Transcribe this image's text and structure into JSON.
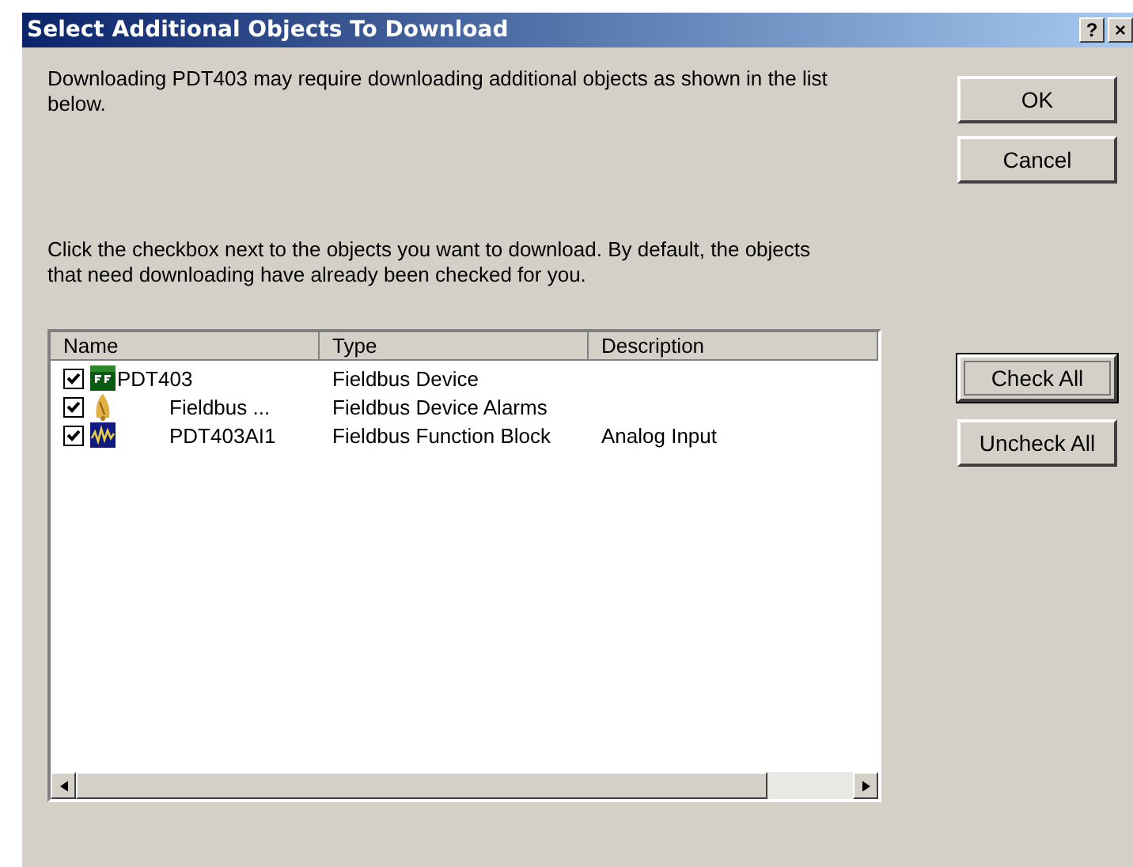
{
  "window": {
    "title": "Select Additional Objects To Download",
    "title_buttons": [
      "?",
      "×"
    ]
  },
  "intro": "Downloading PDT403 may require downloading additional objects as shown in the list below.",
  "instructions": "Click the checkbox next to the objects you want to download. By default, the objects that need downloading have already been checked for you.",
  "dialog_buttons": [
    {
      "label": "OK",
      "focused": false
    },
    {
      "label": "Cancel",
      "focused": false
    }
  ],
  "list_buttons": [
    {
      "label": "Check All",
      "focused": true
    },
    {
      "label": "Uncheck All",
      "focused": false
    }
  ],
  "table": {
    "columns": [
      "Name",
      "Type",
      "Description"
    ],
    "rows": [
      {
        "name": "PDT403",
        "type": "Fieldbus Device",
        "checked": true,
        "kind": "device",
        "children": [
          {
            "name": "Fieldbus ...",
            "type": "Fieldbus Device Alarms",
            "checked": true,
            "kind": "alarms"
          },
          {
            "name": "PDT403AI1",
            "type": "Fieldbus Function Block",
            "description": "Analog Input",
            "checked": true,
            "kind": "block"
          }
        ]
      }
    ]
  }
}
